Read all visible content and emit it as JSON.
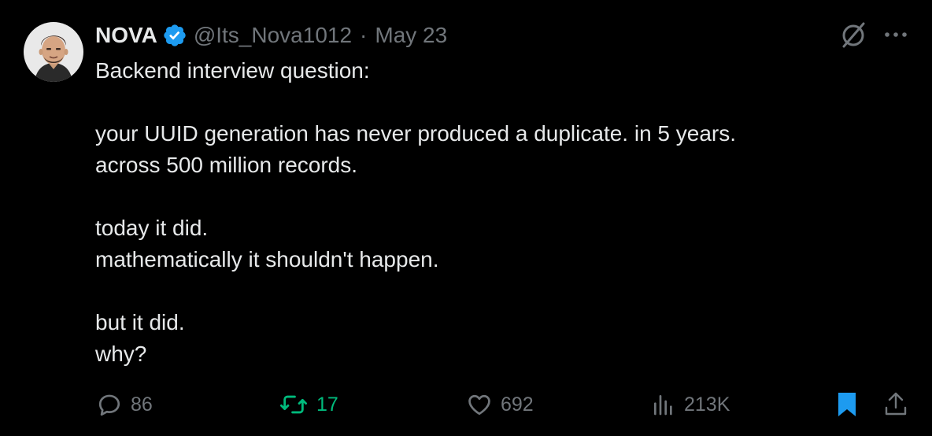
{
  "author": {
    "name": "NOVA",
    "handle": "@Its_Nova1012",
    "separator": "·",
    "date": "May 23"
  },
  "tweet": {
    "lines": [
      "Backend interview question:",
      "",
      "your UUID generation has never produced a duplicate. in 5 years.",
      "across 500 million records.",
      "",
      "today it did.",
      "mathematically it shouldn't happen.",
      "",
      "but it did.",
      "why?"
    ]
  },
  "actions": {
    "replies": "86",
    "retweets": "17",
    "likes": "692",
    "views": "213K"
  },
  "colors": {
    "background": "#000000",
    "text": "#e7e9ea",
    "muted": "#71767b",
    "verified": "#1d9bf0",
    "retweet_active": "#00ba7c",
    "bookmark_active": "#1d9bf0"
  },
  "icons": {
    "verified": "verified-badge-icon",
    "grok": "grok-icon",
    "more": "more-icon",
    "reply": "reply-icon",
    "retweet": "retweet-icon",
    "like": "heart-icon",
    "views": "views-icon",
    "bookmark": "bookmark-icon",
    "share": "share-icon"
  }
}
